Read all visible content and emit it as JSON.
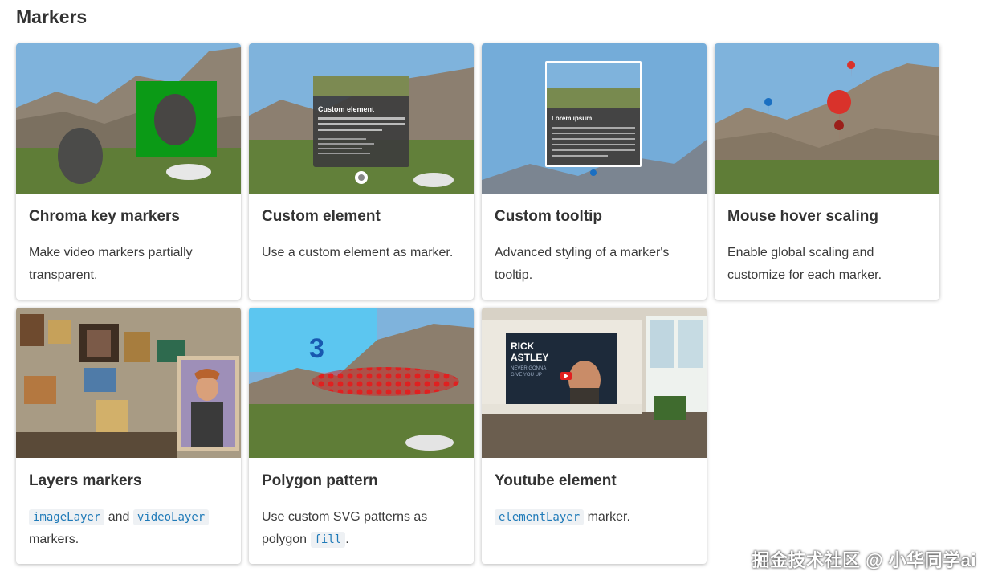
{
  "section": {
    "title": "Markers"
  },
  "cards": [
    {
      "title": "Chroma key markers",
      "desc": "Make video markers partially transparent.",
      "thumb_icon": "trex-chroma-thumbnail"
    },
    {
      "title": "Custom element",
      "desc": "Use a custom element as marker.",
      "thumb": {
        "heading": "Custom element",
        "text": "Use an existing element as marker. This WebComponent contains its own animations and tooltip."
      }
    },
    {
      "title": "Custom tooltip",
      "desc": "Advanced styling of a marker's tooltip.",
      "thumb": {
        "heading": "Lorem ipsum",
        "text": "Vivamus magna. Cras in mi at felis aliquet congue. Ut a est eget ligula molestie gravida."
      }
    },
    {
      "title": "Mouse hover scaling",
      "desc": "Enable global scaling and customize for each marker."
    },
    {
      "title": "Layers markers",
      "desc_parts": {
        "code1": "imageLayer",
        "mid": " and ",
        "code2": "videoLayer",
        "end": " markers."
      }
    },
    {
      "title": "Polygon pattern",
      "desc_parts": {
        "start": "Use custom SVG patterns as polygon ",
        "code1": "fill",
        "end": "."
      },
      "thumb": {
        "number": "3"
      }
    },
    {
      "title": "Youtube element",
      "desc_parts": {
        "code1": "elementLayer",
        "end": " marker."
      },
      "thumb": {
        "line1": "RICK",
        "line2": "ASTLEY",
        "line3": "NEVER GONNA",
        "line4": "GIVE YOU UP"
      }
    }
  ],
  "watermark": "掘金技术社区 @ 小华同学ai",
  "colors": {
    "sky": "#6fa7d6",
    "grass": "#5c7a34",
    "mountain": "#8a7b6b",
    "chroma_green": "#0b9a16",
    "pin_red": "#d9322b",
    "pin_blue": "#1a6fc2"
  }
}
